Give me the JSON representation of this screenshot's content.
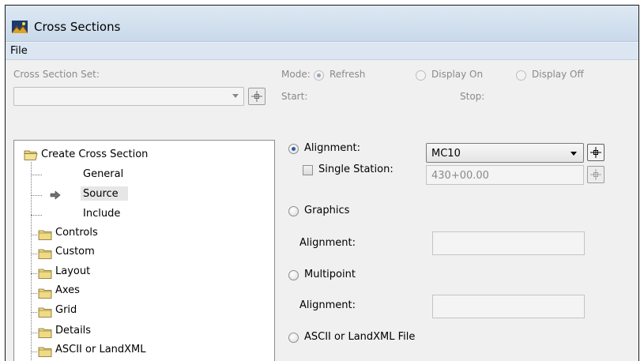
{
  "window": {
    "title": "Cross Sections",
    "icon": "cross-section-app-icon"
  },
  "menu": {
    "file": "File"
  },
  "left": {
    "set_label": "Cross Section Set:",
    "set_value": ""
  },
  "tree": {
    "root": "Create Cross Section",
    "items": [
      {
        "label": "General",
        "type": "leaf"
      },
      {
        "label": "Source",
        "type": "leaf-current"
      },
      {
        "label": "Include",
        "type": "leaf"
      },
      {
        "label": "Controls",
        "type": "folder"
      },
      {
        "label": "Custom",
        "type": "folder"
      },
      {
        "label": "Layout",
        "type": "folder"
      },
      {
        "label": "Axes",
        "type": "folder"
      },
      {
        "label": "Grid",
        "type": "folder"
      },
      {
        "label": "Details",
        "type": "folder"
      },
      {
        "label": "ASCII or LandXML",
        "type": "folder"
      }
    ]
  },
  "mode": {
    "label": "Mode:",
    "options": [
      "Refresh",
      "Display On",
      "Display Off"
    ],
    "selected": "Refresh",
    "start_label": "Start:",
    "stop_label": "Stop:"
  },
  "source": {
    "alignment_radio": "Alignment:",
    "alignment_value": "MC10",
    "single_station_label": "Single Station:",
    "single_station_value": "430+00.00",
    "single_station_checked": false,
    "graphics_radio": "Graphics",
    "graphics_alignment_label": "Alignment:",
    "graphics_alignment_value": "",
    "multipoint_radio": "Multipoint",
    "multipoint_alignment_label": "Alignment:",
    "multipoint_alignment_value": "",
    "ascii_radio": "ASCII or LandXML File",
    "selected": "Alignment"
  },
  "colors": {
    "accent": "#2b5aa8",
    "titlebar": "#c9d9ea",
    "disabled_text": "#8a8a8a"
  }
}
